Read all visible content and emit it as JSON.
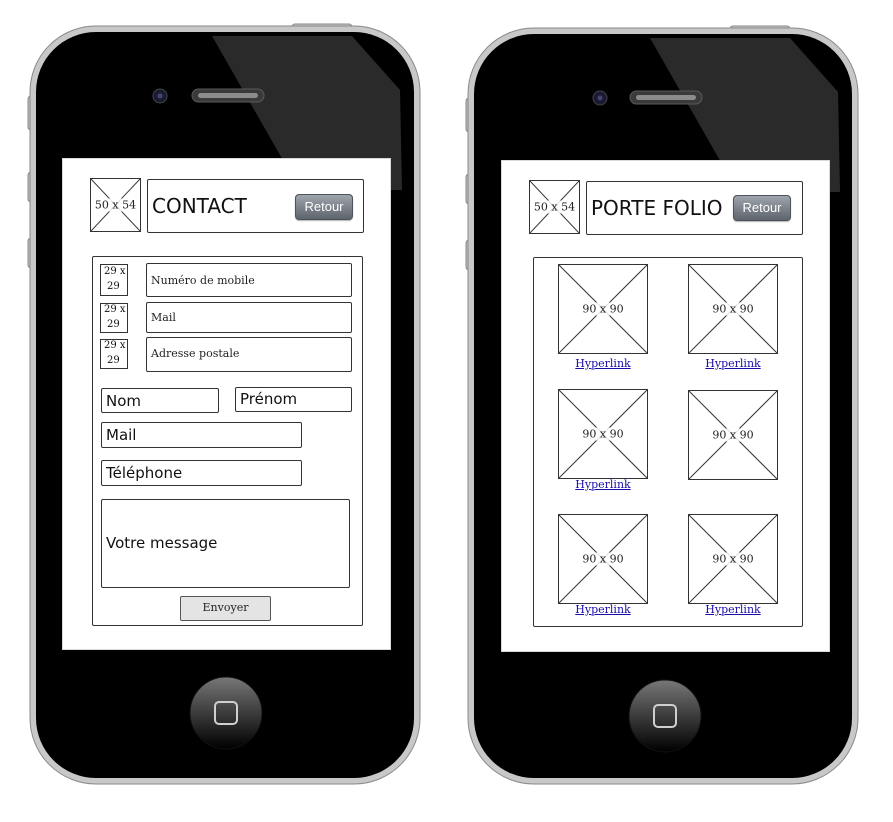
{
  "contact_screen": {
    "logo_placeholder": "50 x 54",
    "title": "CONTACT",
    "back_button": "Retour",
    "info_icon_top": "29 x",
    "info_icon_bottom": "29",
    "contact_rows": [
      "Numéro de mobile",
      "Mail",
      "Adresse postale"
    ],
    "form": {
      "nom": "Nom",
      "prenom": "Prénom",
      "mail": "Mail",
      "telephone": "Téléphone",
      "message": "Votre message",
      "submit": "Envoyer"
    }
  },
  "portfolio_screen": {
    "logo_placeholder": "50 x 54",
    "title": "PORTE FOLIO",
    "back_button": "Retour",
    "items": [
      {
        "image": "90 x 90",
        "link": "Hyperlink"
      },
      {
        "image": "90 x 90",
        "link": "Hyperlink"
      },
      {
        "image": "90 x 90",
        "link": "Hyperlink"
      },
      {
        "image": "90 x 90",
        "link": "Hyperlink"
      },
      {
        "image": "90 x 90",
        "link": "Hyperlink"
      },
      {
        "image": "90 x 90",
        "link": "Hyperlink"
      }
    ]
  }
}
